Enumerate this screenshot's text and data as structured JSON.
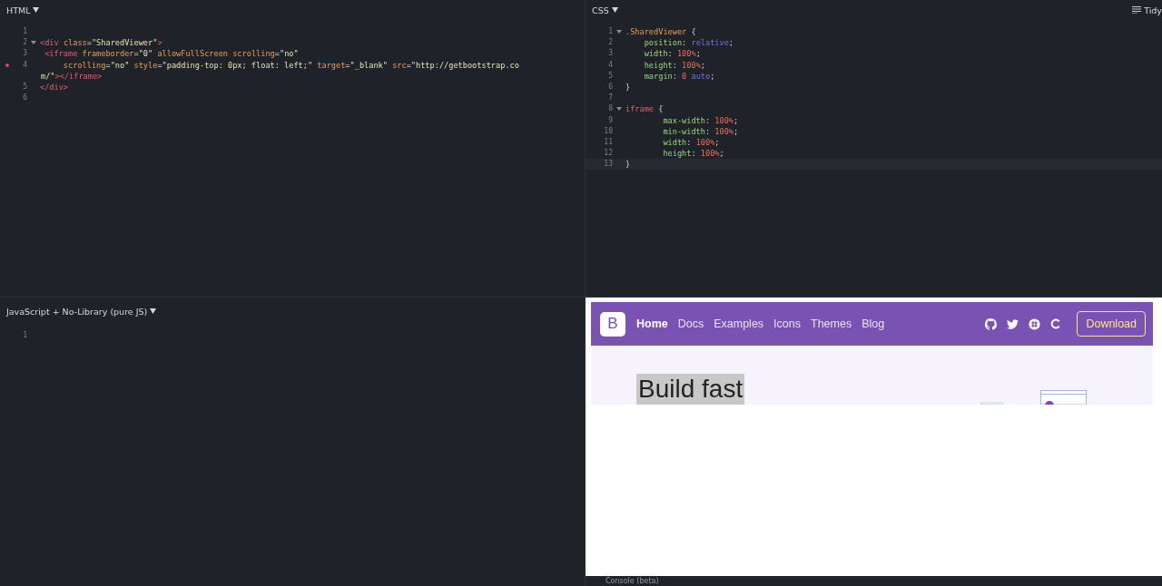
{
  "html_pane": {
    "header": "HTML",
    "lines": [
      {
        "number": "1"
      },
      {
        "number": "2",
        "foldable": true,
        "tokens": [
          {
            "kind": "tag",
            "text": "<div"
          },
          {
            "kind": "attr",
            "text": " class"
          },
          {
            "kind": "punct",
            "text": "="
          },
          {
            "kind": "string",
            "text": "\"SharedViewer\""
          },
          {
            "kind": "tag",
            "text": ">"
          }
        ]
      },
      {
        "number": "3",
        "tokens": [
          {
            "kind": "tag",
            "text": " <iframe"
          },
          {
            "kind": "attr",
            "text": " frameborder"
          },
          {
            "kind": "punct",
            "text": "="
          },
          {
            "kind": "string",
            "text": "\"0\""
          },
          {
            "kind": "attr",
            "text": " allowFullScreen"
          },
          {
            "kind": "attr",
            "text": " scrolling"
          },
          {
            "kind": "punct",
            "text": "="
          },
          {
            "kind": "string",
            "text": "\"no\""
          }
        ]
      },
      {
        "number": "4",
        "error": true,
        "tokens": [
          {
            "kind": "attr",
            "text": "     scrolling"
          },
          {
            "kind": "punct",
            "text": "="
          },
          {
            "kind": "string",
            "text": "\"no\""
          },
          {
            "kind": "attr",
            "text": " style"
          },
          {
            "kind": "punct",
            "text": "="
          },
          {
            "kind": "string",
            "text": "\"padding-top: 0px; float: left;\""
          },
          {
            "kind": "attr",
            "text": " target"
          },
          {
            "kind": "punct",
            "text": "="
          },
          {
            "kind": "string",
            "text": "\"_blank\""
          },
          {
            "kind": "attr",
            "text": " src"
          },
          {
            "kind": "punct",
            "text": "="
          },
          {
            "kind": "string",
            "text": "\"http://getbootstrap.co"
          }
        ],
        "wrapped_tokens": [
          {
            "kind": "string",
            "text": "m/\""
          },
          {
            "kind": "tag",
            "text": "></iframe>"
          }
        ]
      },
      {
        "number": "5",
        "tokens": [
          {
            "kind": "tag",
            "text": "</div>"
          }
        ]
      },
      {
        "number": "6"
      }
    ]
  },
  "css_pane": {
    "header": "CSS",
    "tidy": "Tidy",
    "lines": [
      {
        "number": "1",
        "foldable": true,
        "tokens": [
          {
            "kind": "selector",
            "text": ".SharedViewer"
          },
          {
            "kind": "punct",
            "text": " {"
          }
        ]
      },
      {
        "number": "2",
        "tokens": [
          {
            "kind": "prop",
            "text": "    position"
          },
          {
            "kind": "punct",
            "text": ": "
          },
          {
            "kind": "keyword",
            "text": "relative"
          },
          {
            "kind": "punct",
            "text": ";"
          }
        ]
      },
      {
        "number": "3",
        "tokens": [
          {
            "kind": "prop",
            "text": "    width"
          },
          {
            "kind": "punct",
            "text": ": "
          },
          {
            "kind": "number",
            "text": "100%"
          },
          {
            "kind": "punct",
            "text": ";"
          }
        ]
      },
      {
        "number": "4",
        "tokens": [
          {
            "kind": "prop",
            "text": "    height"
          },
          {
            "kind": "punct",
            "text": ": "
          },
          {
            "kind": "number",
            "text": "100%"
          },
          {
            "kind": "punct",
            "text": ";"
          }
        ]
      },
      {
        "number": "5",
        "tokens": [
          {
            "kind": "prop",
            "text": "    margin"
          },
          {
            "kind": "punct",
            "text": ": "
          },
          {
            "kind": "number",
            "text": "0"
          },
          {
            "kind": "keyword",
            "text": " auto"
          },
          {
            "kind": "punct",
            "text": ";"
          }
        ]
      },
      {
        "number": "6",
        "tokens": [
          {
            "kind": "punct",
            "text": "}"
          }
        ]
      },
      {
        "number": "7"
      },
      {
        "number": "8",
        "foldable": true,
        "tokens": [
          {
            "kind": "tag",
            "text": "iframe"
          },
          {
            "kind": "punct",
            "text": " {"
          }
        ]
      },
      {
        "number": "9",
        "tokens": [
          {
            "kind": "prop",
            "text": "        max-width"
          },
          {
            "kind": "punct",
            "text": ": "
          },
          {
            "kind": "number",
            "text": "100%"
          },
          {
            "kind": "punct",
            "text": ";"
          }
        ]
      },
      {
        "number": "10",
        "tokens": [
          {
            "kind": "prop",
            "text": "        min-width"
          },
          {
            "kind": "punct",
            "text": ": "
          },
          {
            "kind": "number",
            "text": "100%"
          },
          {
            "kind": "punct",
            "text": ";"
          }
        ]
      },
      {
        "number": "11",
        "tokens": [
          {
            "kind": "prop",
            "text": "        width"
          },
          {
            "kind": "punct",
            "text": ": "
          },
          {
            "kind": "number",
            "text": "100%"
          },
          {
            "kind": "punct",
            "text": ";"
          }
        ]
      },
      {
        "number": "12",
        "tokens": [
          {
            "kind": "prop",
            "text": "        height"
          },
          {
            "kind": "punct",
            "text": ": "
          },
          {
            "kind": "number",
            "text": "100%"
          },
          {
            "kind": "punct",
            "text": ";"
          }
        ]
      },
      {
        "number": "13",
        "active": true,
        "tokens": [
          {
            "kind": "punct",
            "text": "}"
          }
        ]
      }
    ]
  },
  "js_pane": {
    "header": "JavaScript + No-Library (pure JS)",
    "lines": [
      {
        "number": "1"
      }
    ]
  },
  "preview": {
    "logo": "B",
    "nav_links": [
      {
        "label": "Home",
        "selected": true
      },
      {
        "label": "Docs",
        "selected": false
      },
      {
        "label": "Examples",
        "selected": false
      },
      {
        "label": "Icons",
        "selected": false
      },
      {
        "label": "Themes",
        "selected": false
      },
      {
        "label": "Blog",
        "selected": false
      }
    ],
    "social_icons": [
      {
        "kind": "github"
      },
      {
        "kind": "twitter"
      },
      {
        "kind": "slack"
      },
      {
        "kind": "opencollective"
      }
    ],
    "download": "Download",
    "heading": "Build fast",
    "heading_highlighted": true
  },
  "console": {
    "label": "Console (beta)"
  }
}
